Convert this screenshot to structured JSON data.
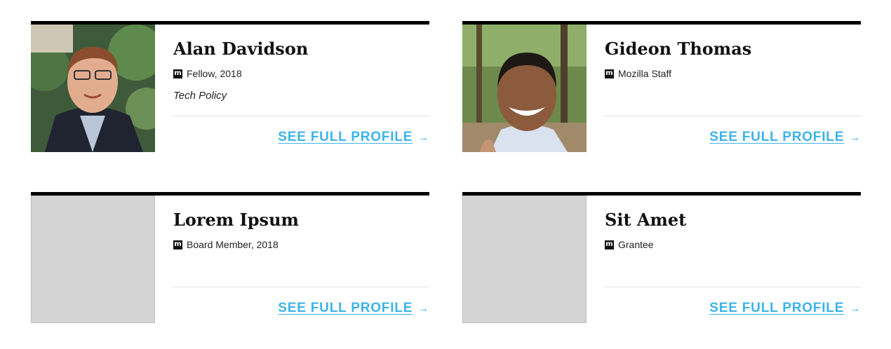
{
  "profiles": [
    {
      "name": "Alan Davidson",
      "badge": "m",
      "role": "Fellow, 2018",
      "topic": "Tech Policy",
      "link_label": "SEE FULL PROFILE",
      "link_arrow": "→",
      "has_photo": true
    },
    {
      "name": "Gideon Thomas",
      "badge": "m",
      "role": "Mozilla Staff",
      "topic": "",
      "link_label": "SEE FULL PROFILE",
      "link_arrow": "→",
      "has_photo": true
    },
    {
      "name": "Lorem Ipsum",
      "badge": "m",
      "role": "Board Member, 2018",
      "topic": "",
      "link_label": "SEE FULL PROFILE",
      "link_arrow": "→",
      "has_photo": false
    },
    {
      "name": "Sit Amet",
      "badge": "m",
      "role": "Grantee",
      "topic": "",
      "link_label": "SEE FULL PROFILE",
      "link_arrow": "→",
      "has_photo": false
    }
  ],
  "colors": {
    "link": "#3db3e8",
    "card_rule": "#000000",
    "placeholder": "#d4d4d4"
  }
}
